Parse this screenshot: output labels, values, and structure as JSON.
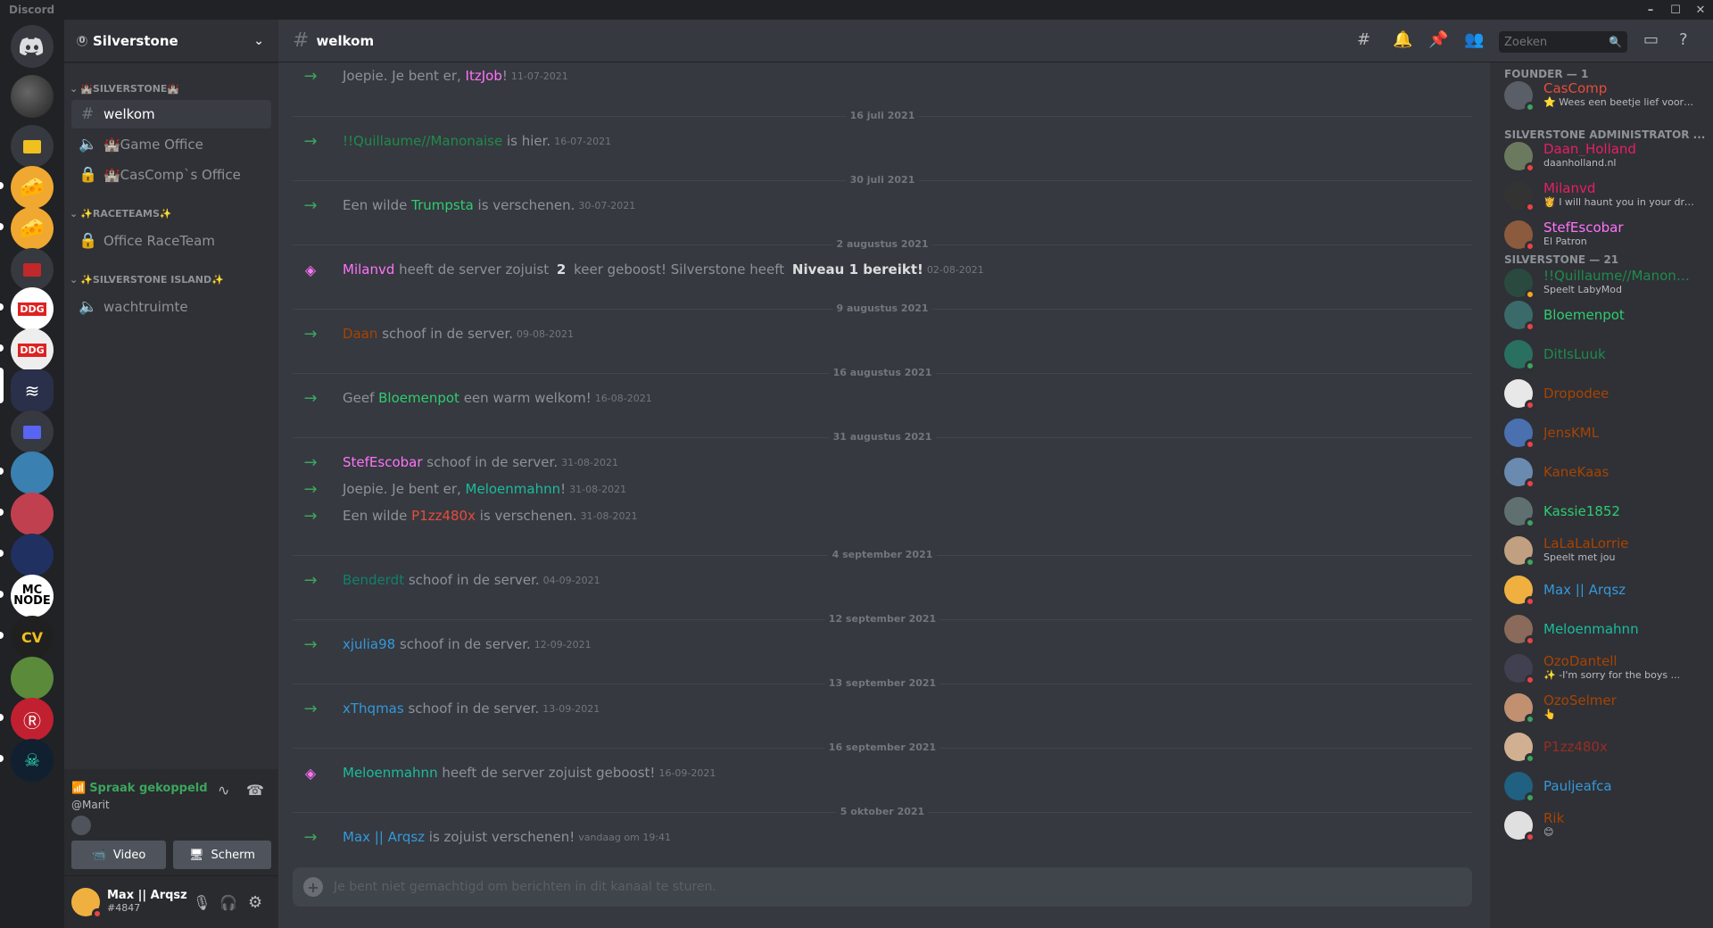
{
  "window": {
    "title": "Discord"
  },
  "server": {
    "name": "Silverstone"
  },
  "categories": [
    {
      "label": "🏰SILVERSTONE🏰"
    },
    {
      "label": "✨RACETEAMS✨"
    },
    {
      "label": "✨SILVERSTONE ISLAND✨"
    }
  ],
  "channels": [
    {
      "label": "welkom",
      "icon": "hash-icon"
    },
    {
      "label": "🏰Game Office",
      "icon": "speaker-icon"
    },
    {
      "label": "🏰CasComp`s Office",
      "icon": "lock-icon"
    },
    {
      "label": "Office RaceTeam",
      "icon": "lock-icon"
    },
    {
      "label": "wachtruimte",
      "icon": "speaker-icon"
    }
  ],
  "voice": {
    "status": "Spraak gekoppeld",
    "channel": "@Marit",
    "video_label": "Video",
    "screen_label": "Scherm"
  },
  "user": {
    "name": "Max || Arqsz",
    "tag": "#4847"
  },
  "header": {
    "channel": "welkom",
    "search_placeholder": "Zoeken"
  },
  "messages": [
    {
      "pre": "Joepie. Je bent er, ",
      "name": "ItzJob",
      "post": "!",
      "ts": "11-07-2021",
      "color": "#ff73fa"
    },
    {
      "divider": "16 juli 2021"
    },
    {
      "pre": "",
      "name": "!!Quillaume//Manonaise",
      "post": " is hier.",
      "ts": "16-07-2021",
      "color": "#1f8b4c"
    },
    {
      "divider": "30 juli 2021"
    },
    {
      "pre": "Een wilde ",
      "name": "Trumpsta",
      "post": " is verschenen.",
      "ts": "30-07-2021",
      "color": "#2ecc71"
    },
    {
      "divider": "2 augustus 2021"
    },
    {
      "boost": true,
      "name": "Milanvd",
      "text1": " heeft de server zojuist ",
      "bold1": "2",
      "text2": " keer geboost! Silverstone heeft ",
      "bold2": "Niveau 1 bereikt!",
      "ts": "02-08-2021",
      "color": "#ff73fa"
    },
    {
      "divider": "9 augustus 2021"
    },
    {
      "pre": "",
      "name": "Daan",
      "post": " schoof in de server.",
      "ts": "09-08-2021",
      "color": "#a84300"
    },
    {
      "divider": "16 augustus 2021"
    },
    {
      "pre": "Geef ",
      "name": "Bloemenpot",
      "post": " een warm welkom!",
      "ts": "16-08-2021",
      "color": "#2ecc71"
    },
    {
      "divider": "31 augustus 2021"
    },
    {
      "pre": "",
      "name": "StefEscobar",
      "post": " schoof in de server.",
      "ts": "31-08-2021",
      "color": "#ff73fa"
    },
    {
      "pre": "Joepie. Je bent er, ",
      "name": "Meloenmahnn",
      "post": "!",
      "ts": "31-08-2021",
      "color": "#1abc9c"
    },
    {
      "pre": "Een wilde ",
      "name": "P1zz480x",
      "post": " is verschenen.",
      "ts": "31-08-2021",
      "color": "#e74c3c"
    },
    {
      "divider": "4 september 2021"
    },
    {
      "pre": "",
      "name": "Benderdt",
      "post": " schoof in de server.",
      "ts": "04-09-2021",
      "color": "#11806a"
    },
    {
      "divider": "12 september 2021"
    },
    {
      "pre": "",
      "name": "xjulia98",
      "post": " schoof in de server.",
      "ts": "12-09-2021",
      "color": "#3498db"
    },
    {
      "divider": "13 september 2021"
    },
    {
      "pre": "",
      "name": "xThqmas",
      "post": " schoof in de server.",
      "ts": "13-09-2021",
      "color": "#3498db"
    },
    {
      "divider": "16 september 2021"
    },
    {
      "boost": true,
      "name": "Meloenmahnn",
      "text1": " heeft de server zojuist geboost!",
      "ts": "16-09-2021",
      "color": "#1abc9c"
    },
    {
      "divider": "5 oktober 2021"
    },
    {
      "pre": "",
      "name": "Max || Arqsz",
      "post": " is zojuist verschenen!",
      "ts": "vandaag om 19:41",
      "color": "#3498db"
    }
  ],
  "input": {
    "placeholder": "Je bent niet gemachtigd om berichten in dit kanaal te sturen."
  },
  "member_groups": [
    {
      "label": "FOUNDER — 1"
    },
    {
      "label": "SILVERSTONE ADMINISTRATOR ..."
    },
    {
      "label": "SILVERSTONE — 21"
    }
  ],
  "members": [
    {
      "name": "CasComp",
      "sub": "⭐ Wees een beetje lief voor e...",
      "color": "#e74c3c",
      "status": "#3ba55d",
      "av": "#5a5e66"
    },
    {
      "name": "Daan_Holland",
      "sub": "daanholland.nl",
      "color": "#e91e63",
      "status": "#ed4245",
      "av": "#6b7a5e"
    },
    {
      "name": "Milanvd",
      "sub": "👸 I will haunt you in your dre...",
      "color": "#e91e63",
      "status": "#ed4245",
      "av": "#333"
    },
    {
      "name": "StefEscobar",
      "sub": "El Patron",
      "color": "#ff73fa",
      "status": "#ed4245",
      "av": "#8c5a3c"
    },
    {
      "name": "!!Quillaume//Manona...",
      "sub": "Speelt LabyMod",
      "color": "#1f8b4c",
      "status": "#faa61a",
      "av": "#2a4a40"
    },
    {
      "name": "Bloemenpot",
      "sub": "",
      "color": "#2ecc71",
      "status": "#ed4245",
      "av": "#3a6a6a"
    },
    {
      "name": "DitIsLuuk",
      "sub": "",
      "color": "#1f8b4c",
      "status": "#3ba55d",
      "av": "#2a7060"
    },
    {
      "name": "Dropodee",
      "sub": "",
      "color": "#a84300",
      "status": "#ed4245",
      "av": "#e8e8e8"
    },
    {
      "name": "JensKML",
      "sub": "",
      "color": "#a84300",
      "status": "#ed4245",
      "av": "#4a70b0"
    },
    {
      "name": "KaneKaas",
      "sub": "",
      "color": "#a84300",
      "status": "#ed4245",
      "av": "#6a8ab0"
    },
    {
      "name": "Kassie1852",
      "sub": "",
      "color": "#2ecc71",
      "status": "#3ba55d",
      "av": "#607070"
    },
    {
      "name": "LaLaLaLorrie",
      "sub": "Speelt met jou",
      "color": "#a84300",
      "status": "#3ba55d",
      "av": "#c0a080"
    },
    {
      "name": "Max || Arqsz",
      "sub": "",
      "color": "#3498db",
      "status": "#ed4245",
      "av": "#f0b040"
    },
    {
      "name": "Meloenmahnn",
      "sub": "",
      "color": "#1abc9c",
      "status": "#ed4245",
      "av": "#8a6a5a"
    },
    {
      "name": "OzoDantell",
      "sub": "✨ -I'm sorry for the boys ...",
      "color": "#a84300",
      "status": "#ed4245",
      "av": "#404050"
    },
    {
      "name": "OzoSelmer",
      "sub": "👆",
      "color": "#a84300",
      "status": "#3ba55d",
      "av": "#c09070"
    },
    {
      "name": "P1zz480x",
      "sub": "",
      "color": "#992d22",
      "status": "#3ba55d",
      "av": "#d0b090"
    },
    {
      "name": "Pauljeafca",
      "sub": "",
      "color": "#3498db",
      "status": "#3ba55d",
      "av": "#206080"
    },
    {
      "name": "Rik",
      "sub": "😊",
      "color": "#a84300",
      "status": "#ed4245",
      "av": "#e0e0e0"
    }
  ]
}
